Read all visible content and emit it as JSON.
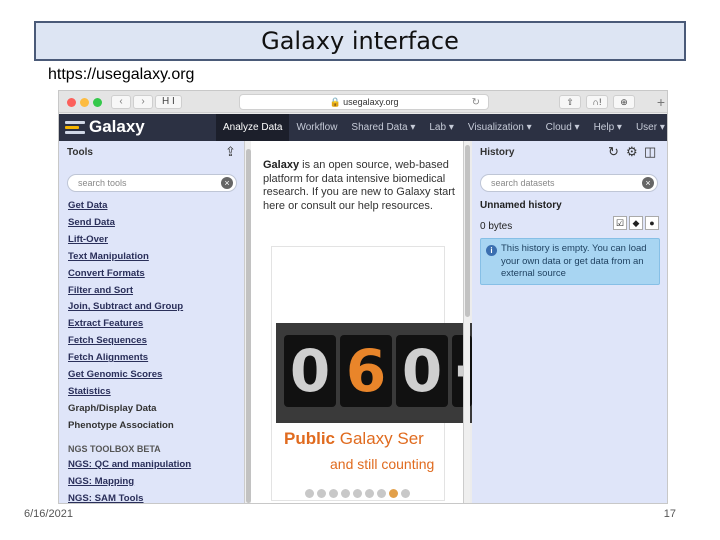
{
  "slide": {
    "title": "Galaxy interface",
    "url": "https://usegalaxy.org",
    "date": "6/16/2021",
    "page_number": "17"
  },
  "browser": {
    "address": "🔒 usegalaxy.org",
    "nav_back": "‹",
    "nav_forward": "›",
    "tab_label": "H I",
    "reload_glyph": "↻",
    "new_tab": "+"
  },
  "masthead": {
    "brand": "Galaxy",
    "nav": [
      {
        "label": "Analyze Data",
        "active": true
      },
      {
        "label": "Workflow"
      },
      {
        "label": "Shared Data ▾"
      },
      {
        "label": "Lab ▾"
      },
      {
        "label": "Visualization ▾"
      },
      {
        "label": "Cloud ▾"
      },
      {
        "label": "Help ▾"
      },
      {
        "label": "User ▾"
      }
    ]
  },
  "tool_panel": {
    "title": "Tools",
    "search_placeholder": "search tools",
    "tools": [
      "Get Data",
      "Send Data",
      "Lift-Over",
      "Text Manipulation",
      "Convert Formats",
      "Filter and Sort",
      "Join, Subtract and Group",
      "Extract Features",
      "Fetch Sequences",
      "Fetch Alignments",
      "Get Genomic Scores",
      "Statistics",
      "Graph/Display Data",
      "Phenotype Association"
    ],
    "section_label": "NGS TOOLBOX BETA",
    "ngs_tools": [
      "NGS: QC and manipulation",
      "NGS: Mapping",
      "NGS: SAM Tools"
    ]
  },
  "center": {
    "welcome_bold": "Galaxy",
    "welcome_text": " is an open source, web-based platform for data intensive biomedical research. If you are new to Galaxy start here or consult our help resources.",
    "counter_digits": [
      "0",
      "6",
      "0",
      "·"
    ],
    "banner_public": "Public",
    "banner_rest": " Galaxy Ser",
    "banner_sub": "and still counting",
    "dots_total": 9,
    "dots_active_index": 7
  },
  "history_panel": {
    "title": "History",
    "search_placeholder": "search datasets",
    "name": "Unnamed history",
    "size": "0 bytes",
    "empty_message": "This history is empty. You can load your own data or get data from an external source"
  }
}
